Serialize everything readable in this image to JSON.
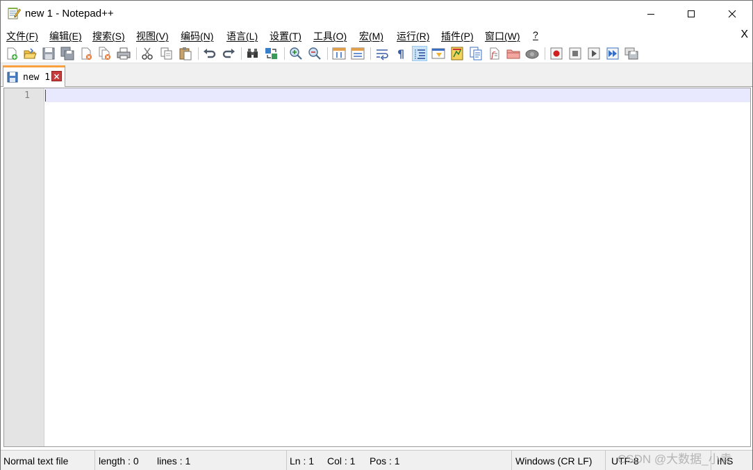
{
  "window": {
    "title": "new 1 - Notepad++",
    "controls": {
      "minimize": "minimize",
      "maximize": "maximize",
      "close": "close"
    }
  },
  "menu": {
    "items": [
      "文件(F)",
      "编辑(E)",
      "搜索(S)",
      "视图(V)",
      "编码(N)",
      "语言(L)",
      "设置(T)",
      "工具(O)",
      "宏(M)",
      "运行(R)",
      "插件(P)",
      "窗口(W)",
      "?"
    ],
    "close_label": "X"
  },
  "toolbar": {
    "buttons": [
      "new-file-icon",
      "open-file-icon",
      "save-icon",
      "save-all-icon",
      "close-icon",
      "close-all-icon",
      "print-icon",
      "cut-icon",
      "copy-icon",
      "paste-icon",
      "undo-icon",
      "redo-icon",
      "find-icon",
      "replace-icon",
      "zoom-in-icon",
      "zoom-out-icon",
      "sync-vertical-icon",
      "sync-horizontal-icon",
      "word-wrap-icon",
      "show-all-characters-icon",
      "indent-guide-icon",
      "user-defined-language-icon",
      "document-map-icon",
      "document-list-icon",
      "function-list-icon",
      "folder-as-workspace-icon",
      "monitoring-icon",
      "record-macro-icon",
      "stop-recording-icon",
      "playback-macro-icon",
      "run-macro-multiple-icon",
      "save-macro-icon"
    ],
    "active": "indent-guide-icon"
  },
  "tabs": [
    {
      "label": "new 1",
      "close_label": "×",
      "active": true
    }
  ],
  "editor": {
    "line_numbers": [
      "1"
    ],
    "content": ""
  },
  "status": {
    "file_type": "Normal text file",
    "length": "length : 0",
    "lines": "lines : 1",
    "ln": "Ln : 1",
    "col": "Col : 1",
    "pos": "Pos : 1",
    "eol": "Windows (CR LF)",
    "encoding": "UTF-8",
    "mode": "INS"
  },
  "watermark": "CSDN @大数据_小袁",
  "colors": {
    "tab_accent": "#f9a03f",
    "current_line": "#e8e8ff",
    "caret": "#8000ff",
    "gutter": "#e4e4e4"
  }
}
